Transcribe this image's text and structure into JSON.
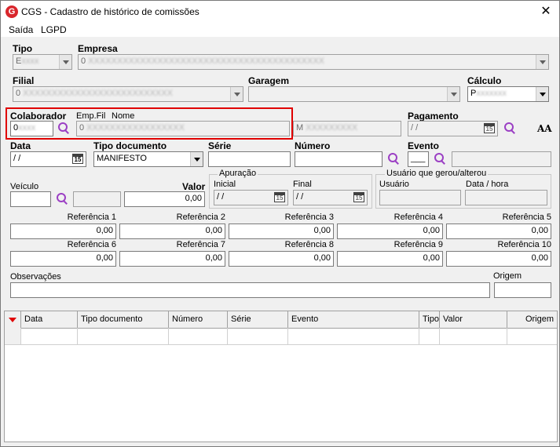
{
  "window": {
    "title": "CGS - Cadastro de histórico de comissões",
    "app_icon_letter": "G"
  },
  "menu": {
    "items": [
      {
        "label": "Saída"
      },
      {
        "label": "LGPD"
      }
    ]
  },
  "row1": {
    "tipo_label": "Tipo",
    "tipo_value": "E",
    "empresa_label": "Empresa",
    "empresa_value": "0"
  },
  "row2": {
    "filial_label": "Filial",
    "filial_value": "0",
    "garagem_label": "Garagem",
    "garagem_value": "",
    "calculo_label": "Cálculo",
    "calculo_value": "P"
  },
  "row3": {
    "colaborador_label": "Colaborador",
    "empfil_label": "Emp.Fil",
    "nome_label": "Nome",
    "colaborador_value": "0",
    "nome_value": "0",
    "extra_value": "M",
    "pagamento_label": "Pagamento",
    "pagamento_value": "/ /"
  },
  "row4": {
    "data_label": "Data",
    "data_value": "/ /",
    "tipo_doc_label": "Tipo documento",
    "tipo_doc_value": "MANIFESTO",
    "serie_label": "Série",
    "numero_label": "Número",
    "evento_label": "Evento",
    "evento_value": "___"
  },
  "row5": {
    "veiculo_label": "Veículo",
    "valor_label": "Valor",
    "valor_value": "0,00",
    "apuracao_label": "Apuração",
    "inicial_label": "Inicial",
    "inicial_value": "/ /",
    "final_label": "Final",
    "final_value": "/ /",
    "usuario_group_label": "Usuário que gerou/alterou",
    "usuario_label": "Usuário",
    "datahora_label": "Data / hora"
  },
  "referencias": {
    "labels": [
      "Referência 1",
      "Referência 2",
      "Referência 3",
      "Referência 4",
      "Referência 5",
      "Referência 6",
      "Referência 7",
      "Referência 8",
      "Referência 9",
      "Referência 10"
    ],
    "values": [
      "0,00",
      "0,00",
      "0,00",
      "0,00",
      "0,00",
      "0,00",
      "0,00",
      "0,00",
      "0,00",
      "0,00"
    ]
  },
  "obs": {
    "observacoes_label": "Observações",
    "origem_label": "Origem"
  },
  "grid": {
    "columns": [
      "Data",
      "Tipo documento",
      "Número",
      "Série",
      "Evento",
      "Tipo",
      "Valor",
      "Origem"
    ]
  },
  "icons": {
    "calendar_text": "15",
    "font_icon_text": "AA"
  },
  "colors": {
    "highlight": "#e00000",
    "search_icon": "#9b3fc4",
    "sort_arrow": "#e00000"
  }
}
